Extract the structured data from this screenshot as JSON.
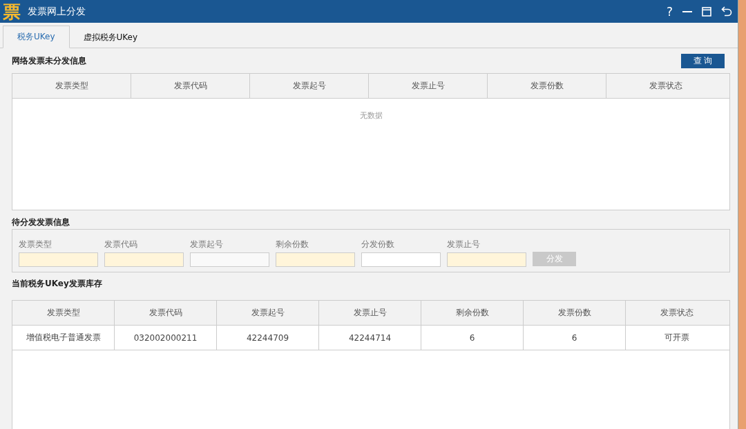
{
  "window": {
    "logo_text": "票",
    "title": "发票网上分发",
    "help": "?"
  },
  "tabs": [
    {
      "label": "税务UKey",
      "selected": true
    },
    {
      "label": "虚拟税务UKey",
      "selected": false
    }
  ],
  "unissued": {
    "title": "网络发票未分发信息",
    "query_button": "查 询",
    "columns": [
      "发票类型",
      "发票代码",
      "发票起号",
      "发票止号",
      "发票份数",
      "发票状态"
    ],
    "empty_text": "无数据"
  },
  "pending": {
    "title": "待分发发票信息",
    "fields": [
      {
        "label": "发票类型",
        "kind": "readonly"
      },
      {
        "label": "发票代码",
        "kind": "readonly"
      },
      {
        "label": "发票起号",
        "kind": "disabled"
      },
      {
        "label": "剩余份数",
        "kind": "readonly"
      },
      {
        "label": "分发份数",
        "kind": "editable"
      },
      {
        "label": "发票止号",
        "kind": "readonly"
      }
    ],
    "button": {
      "label": "分发",
      "disabled": true
    }
  },
  "inventory": {
    "title": "当前税务UKey发票库存",
    "columns": [
      "发票类型",
      "发票代码",
      "发票起号",
      "发票止号",
      "剩余份数",
      "发票份数",
      "发票状态"
    ],
    "rows": [
      [
        "增值税电子普通发票",
        "032002000211",
        "42244709",
        "42244714",
        "6",
        "6",
        "可开票"
      ]
    ]
  }
}
